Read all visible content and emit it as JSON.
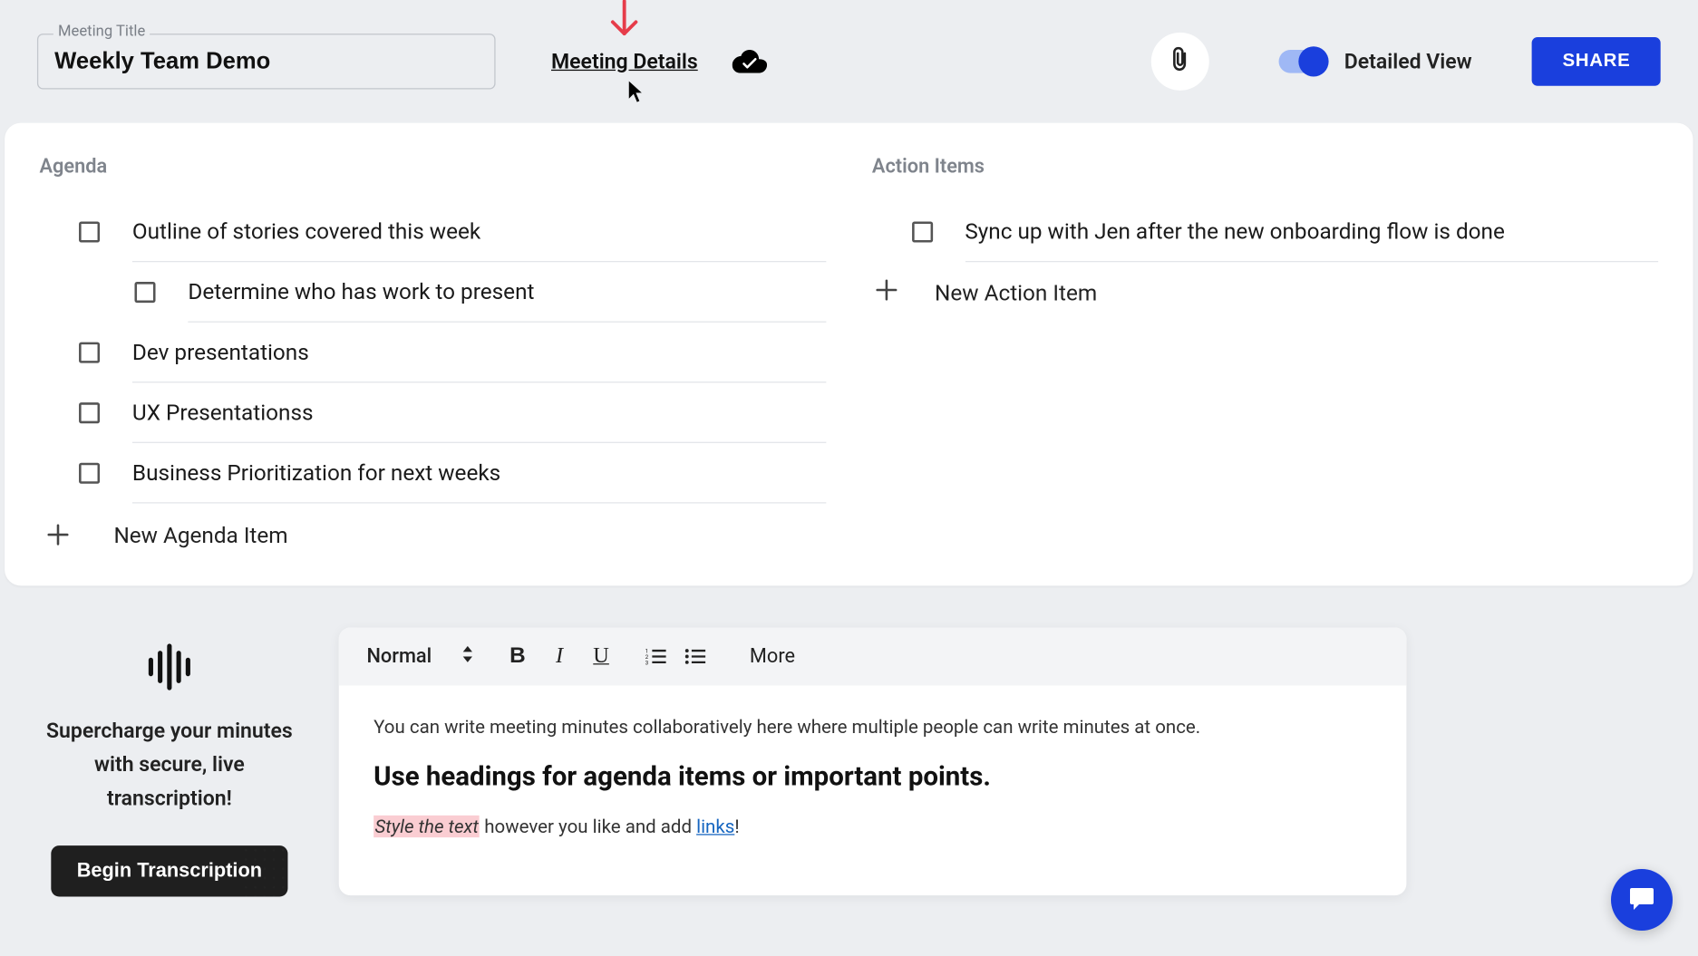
{
  "header": {
    "title_label": "Meeting Title",
    "title_value": "Weekly Team Demo",
    "meeting_details": "Meeting Details",
    "detailed_view_label": "Detailed View",
    "share_label": "SHARE"
  },
  "agenda": {
    "heading": "Agenda",
    "items": [
      {
        "text": "Outline of stories covered this week",
        "sub": false
      },
      {
        "text": "Determine who has work to present",
        "sub": true
      },
      {
        "text": "Dev presentations",
        "sub": false
      },
      {
        "text": "UX Presentationss",
        "sub": false
      },
      {
        "text": "Business Prioritization for next weeks",
        "sub": false
      }
    ],
    "new_item": "New Agenda Item"
  },
  "action_items": {
    "heading": "Action Items",
    "items": [
      {
        "text": "Sync up with Jen after the new onboarding flow is done"
      }
    ],
    "new_item": "New Action Item"
  },
  "transcription": {
    "promo": "Supercharge your minutes with secure, live transcription!",
    "begin": "Begin Transcription"
  },
  "editor": {
    "format": "Normal",
    "more": "More",
    "p1": "You can write meeting minutes collaboratively here where multiple people can write minutes at once.",
    "h2": "Use headings for agenda items or important points.",
    "p2_styled": "Style the text",
    "p2_mid": " however you like and add ",
    "p2_link": "links",
    "p2_end": "!"
  }
}
